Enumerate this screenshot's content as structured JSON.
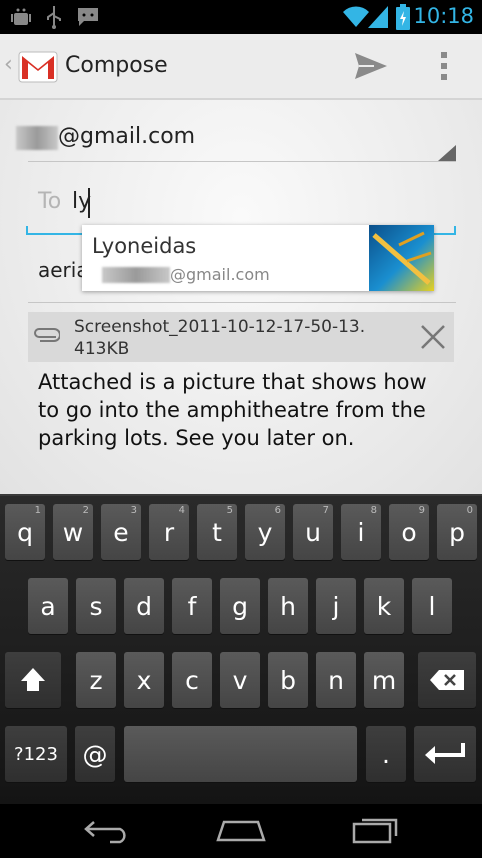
{
  "status_bar": {
    "time": "10:18"
  },
  "action_bar": {
    "title": "Compose"
  },
  "from": {
    "email": "@gmail.com"
  },
  "to": {
    "label": "To",
    "value": "ly"
  },
  "suggestion": {
    "name": "Lyoneidas",
    "email": "@gmail.com"
  },
  "subject": {
    "value": "aeria"
  },
  "attachment": {
    "name": "Screenshot_2011-10-12-17-50-13.",
    "size": "413KB"
  },
  "body": {
    "text": "Attached is a picture that shows how to go into the amphitheatre from the parking lots. See you later on."
  },
  "keyboard": {
    "row1": [
      {
        "k": "q",
        "h": "1"
      },
      {
        "k": "w",
        "h": "2"
      },
      {
        "k": "e",
        "h": "3"
      },
      {
        "k": "r",
        "h": "4"
      },
      {
        "k": "t",
        "h": "5"
      },
      {
        "k": "y",
        "h": "6"
      },
      {
        "k": "u",
        "h": "7"
      },
      {
        "k": "i",
        "h": "8"
      },
      {
        "k": "o",
        "h": "9"
      },
      {
        "k": "p",
        "h": "0"
      }
    ],
    "row2": [
      "a",
      "s",
      "d",
      "f",
      "g",
      "h",
      "j",
      "k",
      "l"
    ],
    "row3": [
      "z",
      "x",
      "c",
      "v",
      "b",
      "n",
      "m"
    ],
    "symbols_label": "?123",
    "at_label": "@",
    "period_label": "."
  },
  "colors": {
    "accent": "#33b5e5",
    "gmail_red": "#d93025"
  }
}
